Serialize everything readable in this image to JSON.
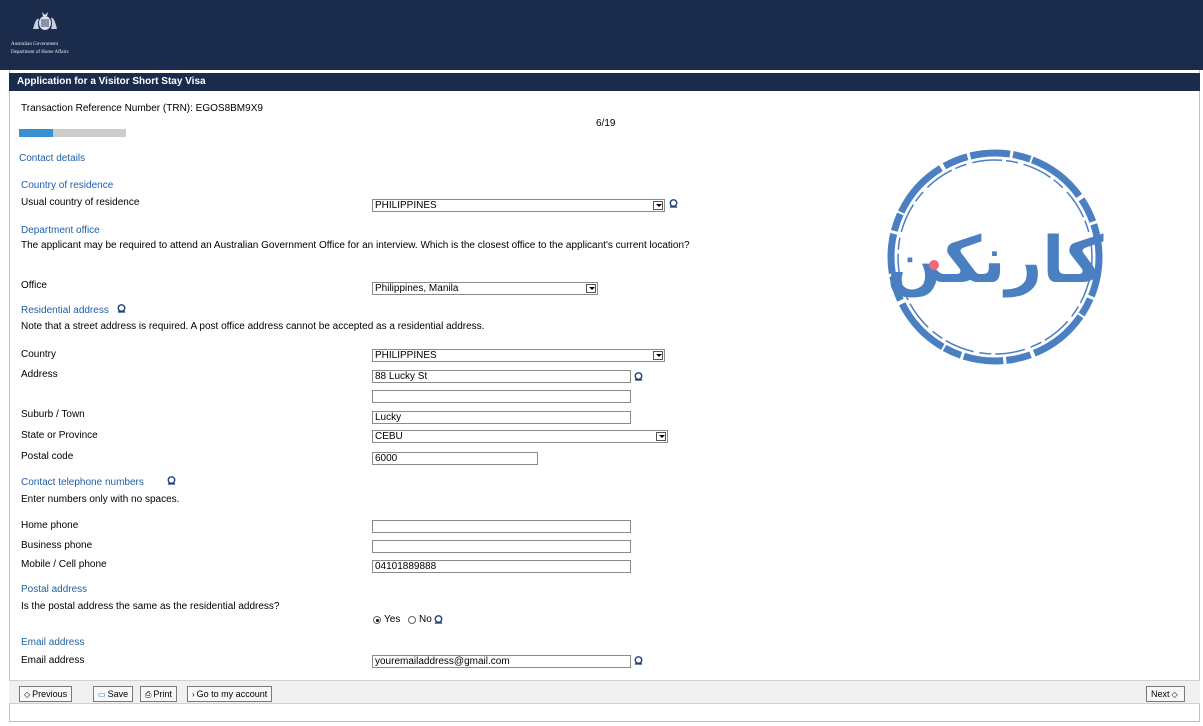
{
  "header": {
    "gov_line1": "Australian Government",
    "gov_line2": "Department of Home Affairs"
  },
  "app": {
    "title": "Application for a Visitor Short Stay Visa",
    "trn": "Transaction Reference Number (TRN): EGOS8BM9X9",
    "page_count": "6/19",
    "progress": 0.32
  },
  "sections": {
    "contact": "Contact details",
    "residence": "Country of residence",
    "department": "Department office",
    "residential": "Residential address",
    "telephone": "Contact telephone numbers",
    "postal": "Postal address",
    "email": "Email address"
  },
  "notes": {
    "department": "The applicant may be required to attend an Australian Government Office for an interview. Which is the closest office to the applicant's current location?",
    "residential": "Note that a street address is required. A post office address cannot be accepted as a residential address.",
    "telephone": "Enter numbers only with no spaces.",
    "postal_question": "Is the postal address the same as the residential address?"
  },
  "labels": {
    "usual_country": "Usual country of residence",
    "office": "Office",
    "country": "Country",
    "address": "Address",
    "suburb": "Suburb / Town",
    "state": "State or Province",
    "postal_code": "Postal code",
    "home_phone": "Home phone",
    "business_phone": "Business phone",
    "mobile": "Mobile / Cell phone",
    "email": "Email address",
    "yes": "Yes",
    "no": "No"
  },
  "values": {
    "usual_country": "PHILIPPINES",
    "office": "Philippines, Manila",
    "country": "PHILIPPINES",
    "address1": "88 Lucky St",
    "address2": "",
    "suburb": "Lucky",
    "state": "CEBU",
    "postal_code": "6000",
    "home_phone": "",
    "business_phone": "",
    "mobile": "04101889888",
    "email": "youremailaddress@gmail.com",
    "postal_same": "Yes"
  },
  "footer": {
    "previous": "Previous",
    "save": "Save",
    "print": "Print",
    "account": "Go to my account",
    "next": "Next"
  },
  "watermark": {
    "text": "کارنکن",
    "color": "#4a7fc1"
  },
  "icons": {
    "help": "help-icon",
    "crest": "coat-of-arms-icon"
  }
}
